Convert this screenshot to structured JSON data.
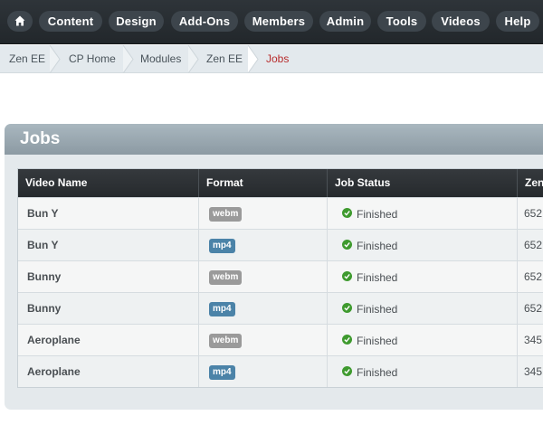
{
  "nav": {
    "items": [
      "Content",
      "Design",
      "Add-Ons",
      "Members",
      "Admin",
      "Tools",
      "Videos",
      "Help"
    ],
    "home_icon": "home-icon"
  },
  "breadcrumb": [
    "Zen EE",
    "CP Home",
    "Modules",
    "Zen EE",
    "Jobs"
  ],
  "panel": {
    "title": "Jobs"
  },
  "table": {
    "headers": [
      "Video Name",
      "Format",
      "Job Status",
      "Zen"
    ],
    "rows": [
      {
        "name": "Bun Y",
        "format": "webm",
        "status": "Finished",
        "zen": "652"
      },
      {
        "name": "Bun Y",
        "format": "mp4",
        "status": "Finished",
        "zen": "652"
      },
      {
        "name": "Bunny",
        "format": "webm",
        "status": "Finished",
        "zen": "652"
      },
      {
        "name": "Bunny",
        "format": "mp4",
        "status": "Finished",
        "zen": "652"
      },
      {
        "name": "Aeroplane",
        "format": "webm",
        "status": "Finished",
        "zen": "345"
      },
      {
        "name": "Aeroplane",
        "format": "mp4",
        "status": "Finished",
        "zen": "345"
      }
    ]
  },
  "colors": {
    "webm": "#9a9a9a",
    "mp4": "#4b83a8",
    "active_crumb": "#b82c2c",
    "finished": "#3e9a2e"
  }
}
